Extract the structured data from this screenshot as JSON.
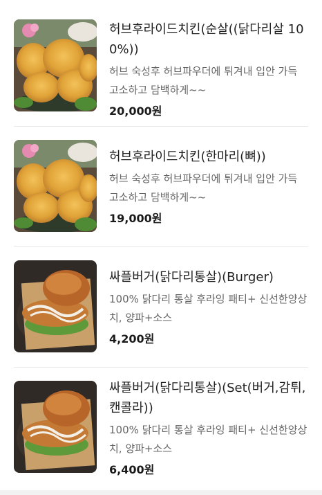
{
  "menu": {
    "items": [
      {
        "name": "허브후라이드치킨(순살((닭다리살 100%))",
        "description": "허브 숙성후 허브파우더에 튀겨내 입안 가득 고소하고 담백하게~~",
        "price": "20,000원",
        "image": "fried-chicken-photo"
      },
      {
        "name": "허브후라이드치킨(한마리(뼈))",
        "description": "허브 숙성후 허브파우더에 튀겨내 입안 가득 고소하고 담백하게~~",
        "price": "19,000원",
        "image": "fried-chicken-photo"
      },
      {
        "name": "싸플버거(닭다리통살)(Burger)",
        "description": "100% 닭다리 통살 후라잉 패티+ 신선한양상치, 양파+소스",
        "price": "4,200원",
        "image": "chicken-burger-photo"
      },
      {
        "name": "싸플버거(닭다리통살)(Set(버거,감튀,캔콜라))",
        "description": "100% 닭다리 통살 후라잉 패티+ 신선한양상치, 양파+소스",
        "price": "6,400원",
        "image": "chicken-burger-photo"
      }
    ]
  }
}
